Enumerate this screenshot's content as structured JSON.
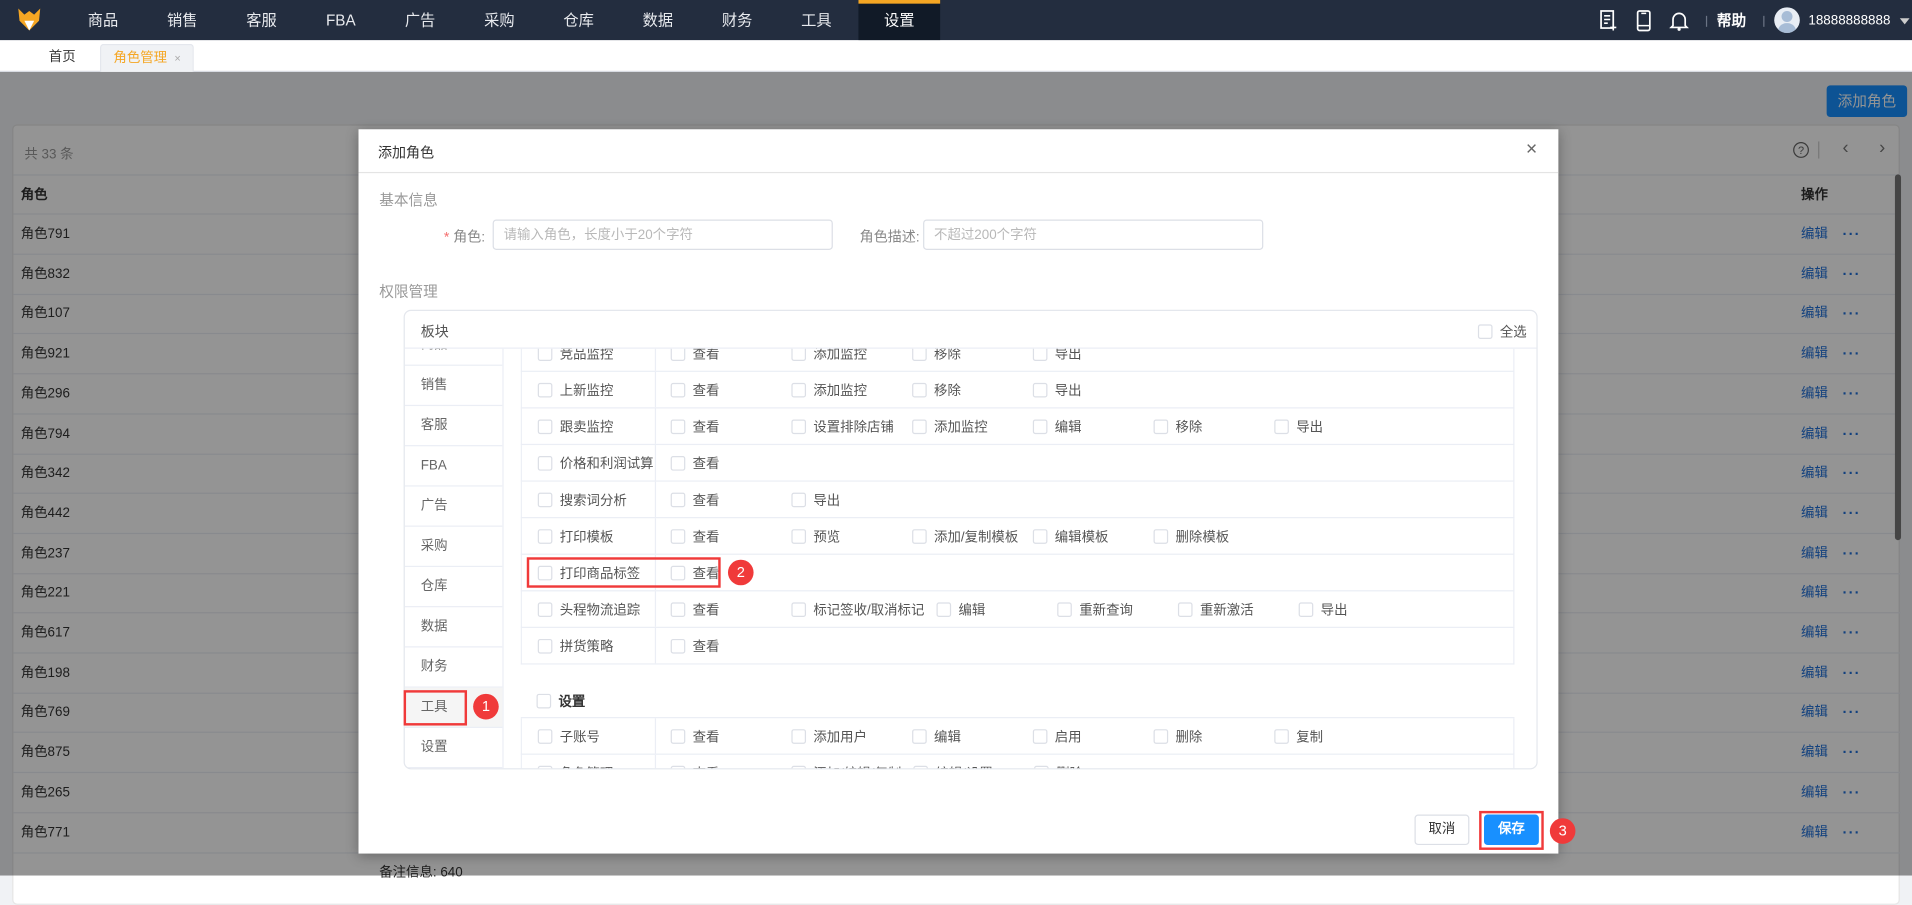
{
  "nav": {
    "items": [
      "商品",
      "销售",
      "客服",
      "FBA",
      "广告",
      "采购",
      "仓库",
      "数据",
      "财务",
      "工具",
      "设置"
    ],
    "active_index": 10,
    "help": "帮助",
    "user": "18888888888"
  },
  "tabs": {
    "home": "首页",
    "active": "角色管理",
    "close": "×"
  },
  "page": {
    "add_role": "添加角色",
    "total": "共 33 条",
    "col_role": "角色",
    "col_action": "操作",
    "edit": "编辑",
    "more": "···",
    "rows": [
      "角色791",
      "角色832",
      "角色107",
      "角色921",
      "角色296",
      "角色794",
      "角色342",
      "角色442",
      "角色237",
      "角色221",
      "角色617",
      "角色198",
      "角色769",
      "角色875",
      "角色265",
      "角色771"
    ],
    "partial_note": "备注信息: 640"
  },
  "dialog": {
    "title": "添加角色",
    "basic_info": "基本信息",
    "role_label": "角色:",
    "required_mark": "*",
    "role_placeholder": "请输入角色，长度小于20个字符",
    "desc_label": "角色描述:",
    "desc_placeholder": "不超过200个字符",
    "perm_title": "权限管理",
    "block_label": "板块",
    "select_all": "全选",
    "sidebar": [
      "商品",
      "销售",
      "客服",
      "FBA",
      "广告",
      "采购",
      "仓库",
      "数据",
      "财务",
      "工具",
      "设置"
    ],
    "sidebar_selected": 9,
    "tool_rows": [
      {
        "name": "竞品监控",
        "items": [
          "查看",
          "添加监控",
          "移除",
          "导出"
        ]
      },
      {
        "name": "上新监控",
        "items": [
          "查看",
          "添加监控",
          "移除",
          "导出"
        ]
      },
      {
        "name": "跟卖监控",
        "items": [
          "查看",
          "设置排除店铺",
          "添加监控",
          "编辑",
          "移除",
          "导出"
        ]
      },
      {
        "name": "价格和利润试算",
        "items": [
          "查看"
        ]
      },
      {
        "name": "搜索词分析",
        "items": [
          "查看",
          "导出"
        ]
      },
      {
        "name": "打印模板",
        "items": [
          "查看",
          "预览",
          "添加/复制模板",
          "编辑模板",
          "删除模板"
        ]
      },
      {
        "name": "打印商品标签",
        "items": [
          "查看"
        ]
      },
      {
        "name": "头程物流追踪",
        "items": [
          "查看",
          "标记签收/取消标记",
          "编辑",
          "重新查询",
          "重新激活",
          "导出"
        ]
      },
      {
        "name": "拼货策略",
        "items": [
          "查看"
        ]
      }
    ],
    "settings_group": "设置",
    "settings_rows": [
      {
        "name": "子账号",
        "items": [
          "查看",
          "添加用户",
          "编辑",
          "启用",
          "删除",
          "复制"
        ]
      },
      {
        "name": "角色管理",
        "items": [
          "查看",
          "添加/编辑/复制",
          "编辑/设置",
          "删除"
        ]
      }
    ],
    "cancel": "取消",
    "save": "保存"
  },
  "callouts": [
    "1",
    "2",
    "3"
  ],
  "colors": {
    "nav_bg": "#232d3f",
    "accent": "#f5a623",
    "primary": "#1890ff",
    "callout": "#f03a3a"
  }
}
